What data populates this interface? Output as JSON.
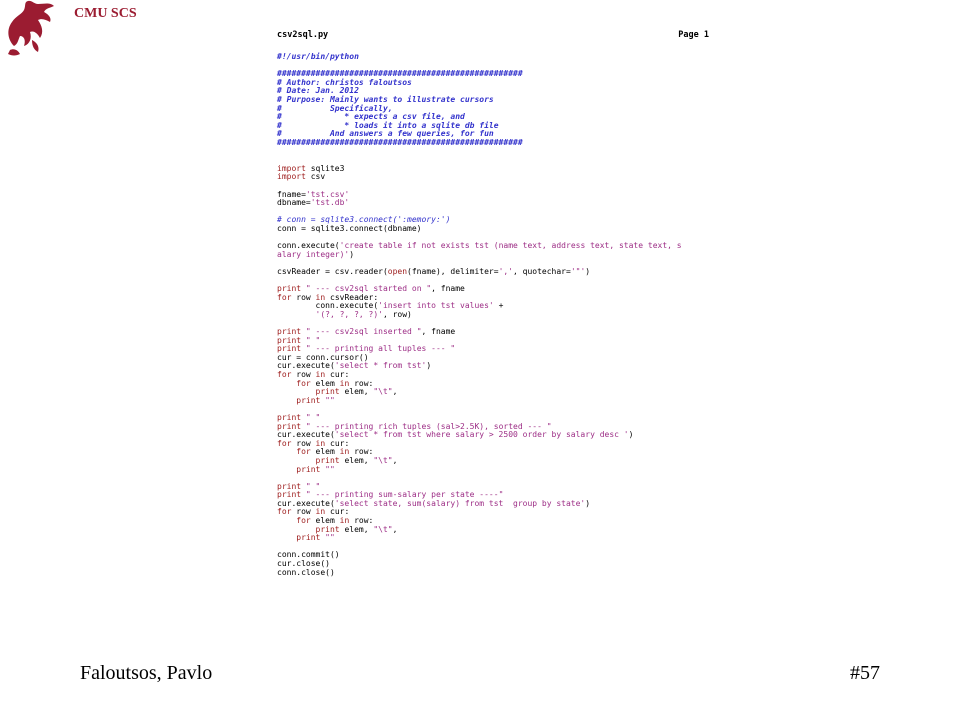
{
  "header": {
    "org": "CMU SCS",
    "logo_icon": "dragon-icon",
    "logo_color": "#9b1c31"
  },
  "listing": {
    "filename": "csv2sql.py",
    "page_label": "Page 1",
    "lines": [
      [
        [
          "bc",
          "#!/usr/bin/python"
        ]
      ],
      [],
      [
        [
          "bc",
          "###################################################"
        ]
      ],
      [
        [
          "bc",
          "# Author: christos faloutsos"
        ]
      ],
      [
        [
          "bc",
          "# Date: Jan. 2012"
        ]
      ],
      [
        [
          "bc",
          "# Purpose: Mainly wants to illustrate cursors"
        ]
      ],
      [
        [
          "bc",
          "#          Specifically,"
        ]
      ],
      [
        [
          "bc",
          "#             * expects a csv file, and"
        ]
      ],
      [
        [
          "bc",
          "#             * loads it into a sqlite db file"
        ]
      ],
      [
        [
          "bc",
          "#          And answers a few queries, for fun"
        ]
      ],
      [
        [
          "bc",
          "###################################################"
        ]
      ],
      [],
      [],
      [
        [
          "k",
          "import"
        ],
        [
          "p",
          " sqlite3"
        ]
      ],
      [
        [
          "k",
          "import"
        ],
        [
          "p",
          " csv"
        ]
      ],
      [],
      [
        [
          "p",
          "fname="
        ],
        [
          "s",
          "'tst.csv'"
        ]
      ],
      [
        [
          "p",
          "dbname="
        ],
        [
          "s",
          "'tst.db'"
        ]
      ],
      [],
      [
        [
          "c",
          "# conn = sqlite3.connect(':memory:')"
        ]
      ],
      [
        [
          "p",
          "conn = sqlite3.connect(dbname)"
        ]
      ],
      [],
      [
        [
          "p",
          "conn.execute("
        ],
        [
          "s",
          "'create table if not exists tst (name text, address text, state text, s"
        ]
      ],
      [
        [
          "s",
          "alary integer)'"
        ],
        [
          "p",
          ")"
        ]
      ],
      [],
      [
        [
          "p",
          "csvReader = csv.reader("
        ],
        [
          "k",
          "open"
        ],
        [
          "p",
          "(fname), delimiter="
        ],
        [
          "s",
          "','"
        ],
        [
          "p",
          ", quotechar="
        ],
        [
          "s",
          "'\"'"
        ],
        [
          "p",
          ")"
        ]
      ],
      [],
      [
        [
          "k",
          "print"
        ],
        [
          "s",
          " \" --- csv2sql started on \""
        ],
        [
          "p",
          ", fname"
        ]
      ],
      [
        [
          "k",
          "for"
        ],
        [
          "p",
          " row "
        ],
        [
          "k",
          "in"
        ],
        [
          "p",
          " csvReader:"
        ]
      ],
      [
        [
          "p",
          "        conn.execute("
        ],
        [
          "s",
          "'insert into tst values'"
        ],
        [
          "p",
          " +"
        ]
      ],
      [
        [
          "s",
          "        '(?, ?, ?, ?)'"
        ],
        [
          "p",
          ", row)"
        ]
      ],
      [],
      [
        [
          "k",
          "print"
        ],
        [
          "s",
          " \" --- csv2sql inserted \""
        ],
        [
          "p",
          ", fname"
        ]
      ],
      [
        [
          "k",
          "print"
        ],
        [
          "s",
          " \" \""
        ]
      ],
      [
        [
          "k",
          "print"
        ],
        [
          "s",
          " \" --- printing all tuples --- \""
        ]
      ],
      [
        [
          "p",
          "cur = conn.cursor()"
        ]
      ],
      [
        [
          "p",
          "cur.execute("
        ],
        [
          "s",
          "'select * from tst'"
        ],
        [
          "p",
          ")"
        ]
      ],
      [
        [
          "k",
          "for"
        ],
        [
          "p",
          " row "
        ],
        [
          "k",
          "in"
        ],
        [
          "p",
          " cur:"
        ]
      ],
      [
        [
          "k",
          "    for"
        ],
        [
          "p",
          " elem "
        ],
        [
          "k",
          "in"
        ],
        [
          "p",
          " row:"
        ]
      ],
      [
        [
          "k",
          "        print"
        ],
        [
          "p",
          " elem, "
        ],
        [
          "s",
          "\"\\t\""
        ],
        [
          "p",
          ","
        ]
      ],
      [
        [
          "k",
          "    print"
        ],
        [
          "s",
          " \"\""
        ]
      ],
      [],
      [
        [
          "k",
          "print"
        ],
        [
          "s",
          " \" \""
        ]
      ],
      [
        [
          "k",
          "print"
        ],
        [
          "s",
          " \" --- printing rich tuples (sal>2.5K), sorted --- \""
        ]
      ],
      [
        [
          "p",
          "cur.execute("
        ],
        [
          "s",
          "'select * from tst where salary > 2500 order by salary desc '"
        ],
        [
          "p",
          ")"
        ]
      ],
      [
        [
          "k",
          "for"
        ],
        [
          "p",
          " row "
        ],
        [
          "k",
          "in"
        ],
        [
          "p",
          " cur:"
        ]
      ],
      [
        [
          "k",
          "    for"
        ],
        [
          "p",
          " elem "
        ],
        [
          "k",
          "in"
        ],
        [
          "p",
          " row:"
        ]
      ],
      [
        [
          "k",
          "        print"
        ],
        [
          "p",
          " elem, "
        ],
        [
          "s",
          "\"\\t\""
        ],
        [
          "p",
          ","
        ]
      ],
      [
        [
          "k",
          "    print"
        ],
        [
          "s",
          " \"\""
        ]
      ],
      [],
      [
        [
          "k",
          "print"
        ],
        [
          "s",
          " \" \""
        ]
      ],
      [
        [
          "k",
          "print"
        ],
        [
          "s",
          " \" --- printing sum-salary per state ----\""
        ]
      ],
      [
        [
          "p",
          "cur.execute("
        ],
        [
          "s",
          "'select state, sum(salary) from tst  group by state'"
        ],
        [
          "p",
          ")"
        ]
      ],
      [
        [
          "k",
          "for"
        ],
        [
          "p",
          " row "
        ],
        [
          "k",
          "in"
        ],
        [
          "p",
          " cur:"
        ]
      ],
      [
        [
          "k",
          "    for"
        ],
        [
          "p",
          " elem "
        ],
        [
          "k",
          "in"
        ],
        [
          "p",
          " row:"
        ]
      ],
      [
        [
          "k",
          "        print"
        ],
        [
          "p",
          " elem, "
        ],
        [
          "s",
          "\"\\t\""
        ],
        [
          "p",
          ","
        ]
      ],
      [
        [
          "k",
          "    print"
        ],
        [
          "s",
          " \"\""
        ]
      ],
      [],
      [
        [
          "p",
          "conn.commit()"
        ]
      ],
      [
        [
          "p",
          "cur.close()"
        ]
      ],
      [
        [
          "p",
          "conn.close()"
        ]
      ]
    ]
  },
  "footer": {
    "authors": "Faloutsos, Pavlo",
    "slide_number": "#57"
  }
}
